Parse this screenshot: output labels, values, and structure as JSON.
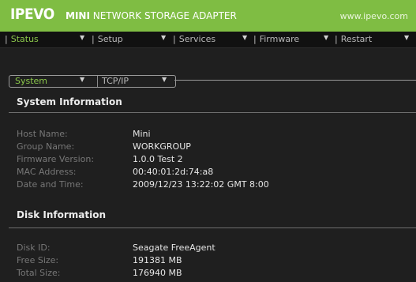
{
  "header": {
    "logo": "IPEVO",
    "subtitle_bold": "MINI",
    "subtitle_rest": "NETWORK STORAGE ADAPTER",
    "url": "www.ipevo.com",
    "accent": "#7fbd43"
  },
  "nav": {
    "items": [
      {
        "label": "Status",
        "active": true
      },
      {
        "label": "Setup",
        "active": false
      },
      {
        "label": "Services",
        "active": false
      },
      {
        "label": "Firmware",
        "active": false
      },
      {
        "label": "Restart",
        "active": false
      }
    ],
    "separator": "|",
    "caret": "▼"
  },
  "subtabs": {
    "items": [
      {
        "label": "System",
        "active": true
      },
      {
        "label": "TCP/IP",
        "active": false
      }
    ]
  },
  "system_info": {
    "title": "System Information",
    "rows": [
      {
        "label": "Host Name:",
        "value": "Mini"
      },
      {
        "label": "Group Name:",
        "value": "WORKGROUP"
      },
      {
        "label": "Firmware Version:",
        "value": "1.0.0 Test 2"
      },
      {
        "label": "MAC Address:",
        "value": "00:40:01:2d:74:a8"
      },
      {
        "label": "Date and Time:",
        "value": "2009/12/23 13:22:02 GMT 8:00"
      }
    ]
  },
  "disk_info": {
    "title": "Disk Information",
    "rows": [
      {
        "label": "Disk ID:",
        "value": "Seagate FreeAgent"
      },
      {
        "label": "Free Size:",
        "value": "191381 MB"
      },
      {
        "label": "Total Size:",
        "value": "176940 MB"
      }
    ]
  }
}
